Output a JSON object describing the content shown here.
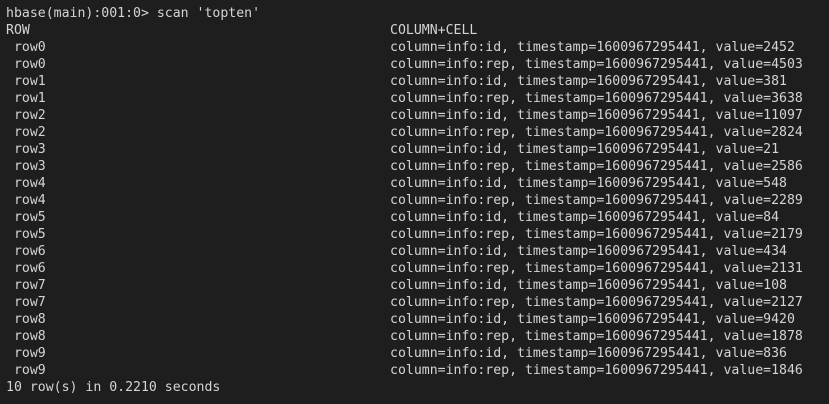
{
  "terminal": {
    "prompt_line": "hbase(main):001:0> scan 'topten'",
    "header": {
      "row": "ROW",
      "cell": "COLUMN+CELL"
    },
    "rows": [
      {
        "row": " row0",
        "cell": "column=info:id, timestamp=1600967295441, value=2452"
      },
      {
        "row": " row0",
        "cell": "column=info:rep, timestamp=1600967295441, value=4503"
      },
      {
        "row": " row1",
        "cell": "column=info:id, timestamp=1600967295441, value=381"
      },
      {
        "row": " row1",
        "cell": "column=info:rep, timestamp=1600967295441, value=3638"
      },
      {
        "row": " row2",
        "cell": "column=info:id, timestamp=1600967295441, value=11097"
      },
      {
        "row": " row2",
        "cell": "column=info:rep, timestamp=1600967295441, value=2824"
      },
      {
        "row": " row3",
        "cell": "column=info:id, timestamp=1600967295441, value=21"
      },
      {
        "row": " row3",
        "cell": "column=info:rep, timestamp=1600967295441, value=2586"
      },
      {
        "row": " row4",
        "cell": "column=info:id, timestamp=1600967295441, value=548"
      },
      {
        "row": " row4",
        "cell": "column=info:rep, timestamp=1600967295441, value=2289"
      },
      {
        "row": " row5",
        "cell": "column=info:id, timestamp=1600967295441, value=84"
      },
      {
        "row": " row5",
        "cell": "column=info:rep, timestamp=1600967295441, value=2179"
      },
      {
        "row": " row6",
        "cell": "column=info:id, timestamp=1600967295441, value=434"
      },
      {
        "row": " row6",
        "cell": "column=info:rep, timestamp=1600967295441, value=2131"
      },
      {
        "row": " row7",
        "cell": "column=info:id, timestamp=1600967295441, value=108"
      },
      {
        "row": " row7",
        "cell": "column=info:rep, timestamp=1600967295441, value=2127"
      },
      {
        "row": " row8",
        "cell": "column=info:id, timestamp=1600967295441, value=9420"
      },
      {
        "row": " row8",
        "cell": "column=info:rep, timestamp=1600967295441, value=1878"
      },
      {
        "row": " row9",
        "cell": "column=info:id, timestamp=1600967295441, value=836"
      },
      {
        "row": " row9",
        "cell": "column=info:rep, timestamp=1600967295441, value=1846"
      }
    ],
    "summary": "10 row(s) in 0.2210 seconds"
  },
  "colors": {
    "background": "#1e1e1e",
    "foreground": "#d4d4d4"
  }
}
